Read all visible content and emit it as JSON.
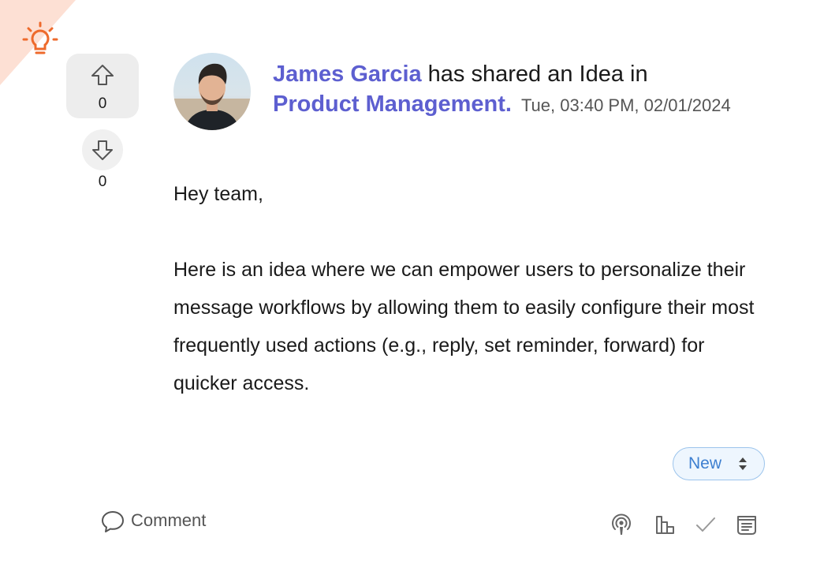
{
  "post": {
    "author": "James Garcia",
    "action_text": "has shared an Idea in",
    "category": "Product Management.",
    "timestamp": "Tue, 03:40 PM, 02/01/2024",
    "greeting": "Hey team,",
    "content": "Here is an idea where we can empower users to personalize their message workflows by allowing them to easily configure their most frequently used actions (e.g., reply, set reminder, forward) for quicker access."
  },
  "votes": {
    "up_count": "0",
    "down_count": "0"
  },
  "status": {
    "selected": "New"
  },
  "footer": {
    "comment_label": "Comment"
  },
  "colors": {
    "link": "#5d5fd0",
    "accent_orange": "#ee6a2c",
    "status_blue": "#3d7fd0",
    "ribbon": "#fde0d4"
  },
  "icons": {
    "corner": "lightbulb-icon",
    "upvote": "arrow-up-icon",
    "downvote": "arrow-down-icon",
    "status": "sort-arrows-icon",
    "comment": "speech-bubble-icon",
    "tools": [
      "podcast-icon",
      "bar-chart-icon",
      "checkmark-icon",
      "notes-icon"
    ]
  }
}
